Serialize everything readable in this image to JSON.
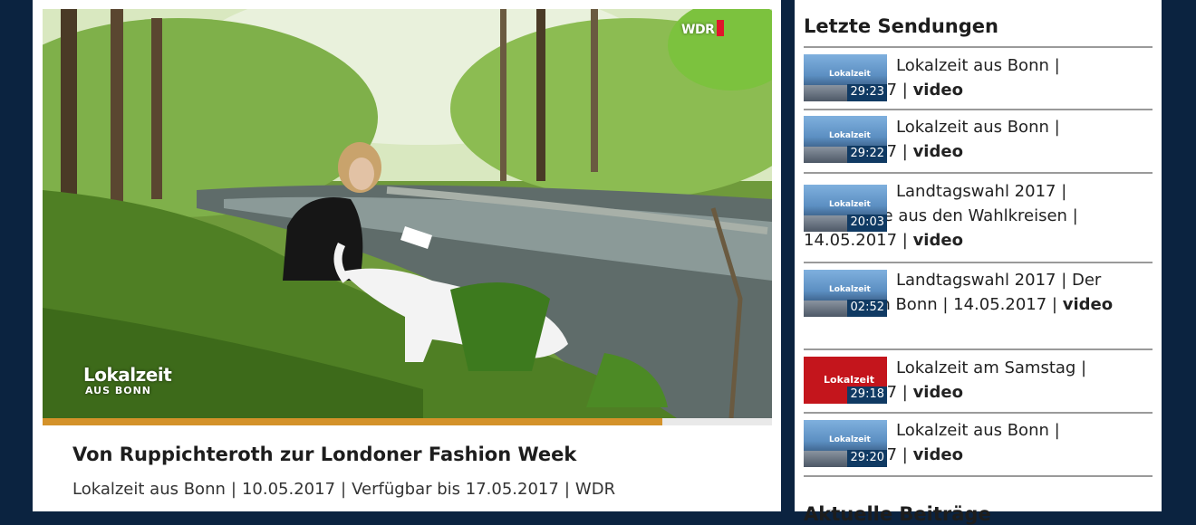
{
  "video": {
    "title": "Von Ruppichteroth zur Londoner Fashion Week",
    "meta": [
      "Lokalzeit aus Bonn",
      "10.05.2017",
      "Verfügbar bis 17.05.2017",
      "WDR"
    ],
    "separator": "|",
    "logo_line1": "Lokalzeit",
    "logo_line2": "AUS BONN",
    "channel_badge": "WDR",
    "progress": 0.85,
    "colors": {
      "progress": "#d4922a",
      "badge_red": "#e0152b"
    }
  },
  "sidebar": {
    "heading": "Letzte Sendungen",
    "items": [
      {
        "line": "Lokalzeit aus Bonn | 16.05.2017 | ",
        "tag": "video",
        "duration": "29:23",
        "thumb_logo": "Lokalzeit",
        "thumb_style": "blue"
      },
      {
        "line": "Lokalzeit aus Bonn | 15.05.2017 | ",
        "tag": "video",
        "duration": "29:22",
        "thumb_logo": "Lokalzeit",
        "thumb_style": "blue"
      },
      {
        "line": "Landtagswahl 2017 | Ergebnisse aus den Wahlkreisen | 14.05.2017 | ",
        "tag": "video",
        "duration": "20:03",
        "thumb_logo": "Lokalzeit",
        "thumb_style": "blue"
      },
      {
        "line": "Landtagswahl 2017 | Der Wahltag in Bonn | 14.05.2017 | ",
        "tag": "video",
        "duration": "02:52",
        "thumb_logo": "Lokalzeit",
        "thumb_style": "blue"
      },
      {
        "line": "Lokalzeit am Samstag | 13.05.2017 | ",
        "tag": "video",
        "duration": "29:18",
        "thumb_logo": "Lokalzeit",
        "thumb_style": "red"
      },
      {
        "line": "Lokalzeit aus Bonn | 12.05.2017 | ",
        "tag": "video",
        "duration": "29:20",
        "thumb_logo": "Lokalzeit",
        "thumb_style": "blue"
      }
    ],
    "next_heading": "Aktuelle Beiträge"
  }
}
